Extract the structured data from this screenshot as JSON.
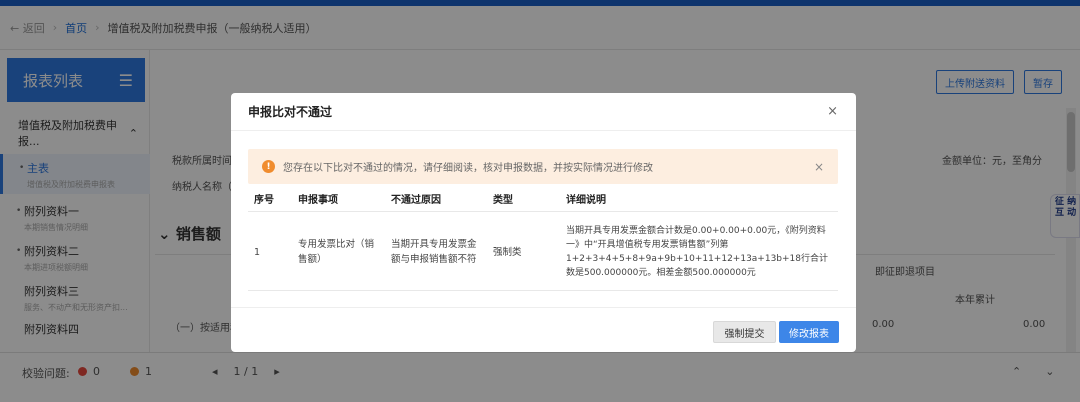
{
  "breadcrumb": {
    "back": "← 返回",
    "home": "首页",
    "separator": "›",
    "current": "增值税及附加税费申报（一般纳税人适用）"
  },
  "sidebar": {
    "title": "报表列表",
    "group": "增值税及附加税费申报...",
    "items": [
      {
        "label": "主表",
        "sub": "增值税及附加税费申报表"
      },
      {
        "label": "附列资料一",
        "sub": "本期销售情况明细"
      },
      {
        "label": "附列资料二",
        "sub": "本期进项税额明细"
      },
      {
        "label": "附列资料三",
        "sub": "服务、不动产和无形资产扣..."
      },
      {
        "label": "附列资料四",
        "sub": ""
      }
    ]
  },
  "main": {
    "upload_btn": "上传附送资料",
    "save_btn": "暂存",
    "period_label": "税款所属时间",
    "taxpayer_label": "纳税人名称（",
    "unit": "金额单位：元，至角分",
    "section": "销售额",
    "col_right": "即征即退项目",
    "col_year": "本年累计",
    "row_label": "（一）按适用税",
    "value_a": "0.00",
    "value_b": "0.00"
  },
  "footer": {
    "label": "校验问题:",
    "errors": "0",
    "warnings": "1",
    "page": "1 / 1"
  },
  "float_help": "征 纳 互 动",
  "modal": {
    "title": "申报比对不通过",
    "close": "×",
    "alert": "您存在以下比对不通过的情况，请仔细阅读，核对申报数据，并按实际情况进行修改",
    "columns": [
      "序号",
      "申报事项",
      "不通过原因",
      "类型",
      "详细说明"
    ],
    "rows": [
      {
        "no": "1",
        "item": "专用发票比对（销售额）",
        "reason": "当期开具专用发票金额与申报销售额不符",
        "type": "强制类",
        "detail": "当期开具专用发票金额合计数是0.00+0.00+0.00元，《附列资料一》中“开具增值税专用发票销售额”列第1+2+3+4+5+8+9a+9b+10+11+12+13a+13b+18行合计数是500.000000元。相差金额500.000000元"
      }
    ],
    "force_submit": "强制提交",
    "modify": "修改报表"
  },
  "colors": {
    "primary": "#2f79e0",
    "alert_bg": "#fdeee0",
    "alert_icon": "#f08c2e"
  }
}
